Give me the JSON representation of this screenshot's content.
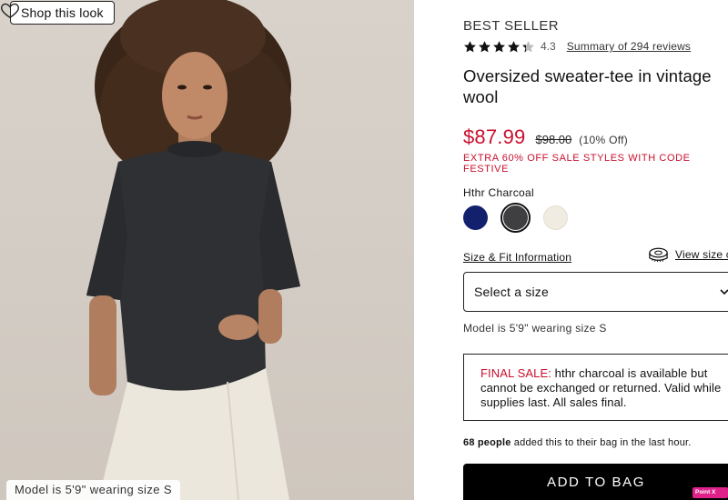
{
  "image_panel": {
    "shop_button": "Shop this look",
    "caption": "Model is 5'9\" wearing size S",
    "icons": {
      "wishlist": "heart-icon"
    }
  },
  "product": {
    "badge": "BEST SELLER",
    "rating": {
      "value": 4.3,
      "text": "4.3",
      "stars_max": 5
    },
    "reviews_link": "Summary of 294 reviews",
    "title": "Oversized sweater-tee in vintage wool",
    "price": {
      "sale": "$87.99",
      "original": "$98.00",
      "discount": "(10% Off)"
    },
    "promo": "EXTRA 60% OFF SALE STYLES WITH CODE FESTIVE",
    "color": {
      "selected_name": "Hthr Charcoal",
      "swatches": [
        {
          "name": "navy",
          "hex": "#13206e"
        },
        {
          "name": "charcoal",
          "hex": "#3f3f41",
          "selected": true
        },
        {
          "name": "ivory",
          "hex": "#f1ece1"
        }
      ]
    },
    "size_fit_link": "Size & Fit Information",
    "view_size_chart": "View size ch",
    "size_select": {
      "placeholder": "Select a size"
    },
    "model_note": "Model is 5'9\" wearing size S",
    "final_sale": {
      "label": "FINAL SALE:",
      "text": " hthr charcoal is available but cannot be exchanged or returned. Valid while supplies last. All sales final."
    },
    "bag_activity": {
      "count": "68 people",
      "text": " added this to their bag in the last hour."
    },
    "add_to_bag": "ADD TO BAG"
  },
  "overlay_badge": "Point X Ute",
  "colors": {
    "accent_red": "#c8102e",
    "button_black": "#000000",
    "text": "#111111"
  }
}
